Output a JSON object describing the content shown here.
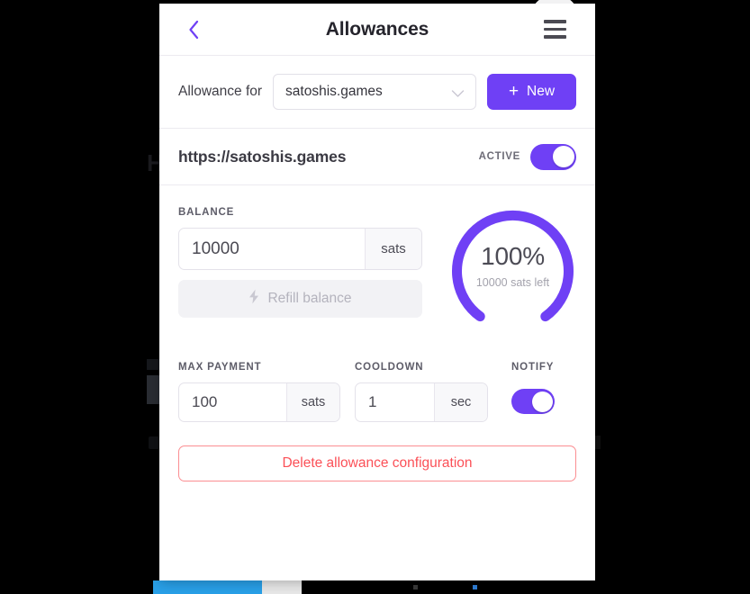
{
  "background": {
    "partial_letter": "H"
  },
  "header": {
    "back_icon": "chevron-left-icon",
    "title": "Allowances",
    "menu_icon": "hamburger-menu-icon"
  },
  "picker": {
    "label": "Allowance for",
    "selected": "satoshis.games",
    "caret_icon": "chevron-down-icon",
    "new_button": {
      "plus": "+",
      "label": "New"
    }
  },
  "site": {
    "url": "https://satoshis.games",
    "active_label": "ACTIVE",
    "active_on": true
  },
  "balance": {
    "label": "BALANCE",
    "value": "10000",
    "unit": "sats",
    "refill_label": "Refill balance",
    "refill_icon": "lightning-bolt-icon"
  },
  "gauge": {
    "percent_label": "100%",
    "percent_value": 100,
    "sub_label": "10000 sats left",
    "track_color": "#ece9fb",
    "arc_color": "#6f40f5"
  },
  "max_payment": {
    "label": "MAX PAYMENT",
    "value": "100",
    "unit": "sats"
  },
  "cooldown": {
    "label": "COOLDOWN",
    "value": "1",
    "unit": "sec"
  },
  "notify": {
    "label": "NOTIFY",
    "on": true
  },
  "delete": {
    "label": "Delete allowance configuration"
  },
  "colors": {
    "accent": "#6f40f5",
    "danger": "#fb5057",
    "danger_border": "#fb8e92",
    "taskbar_blue": "#29a0e8"
  }
}
